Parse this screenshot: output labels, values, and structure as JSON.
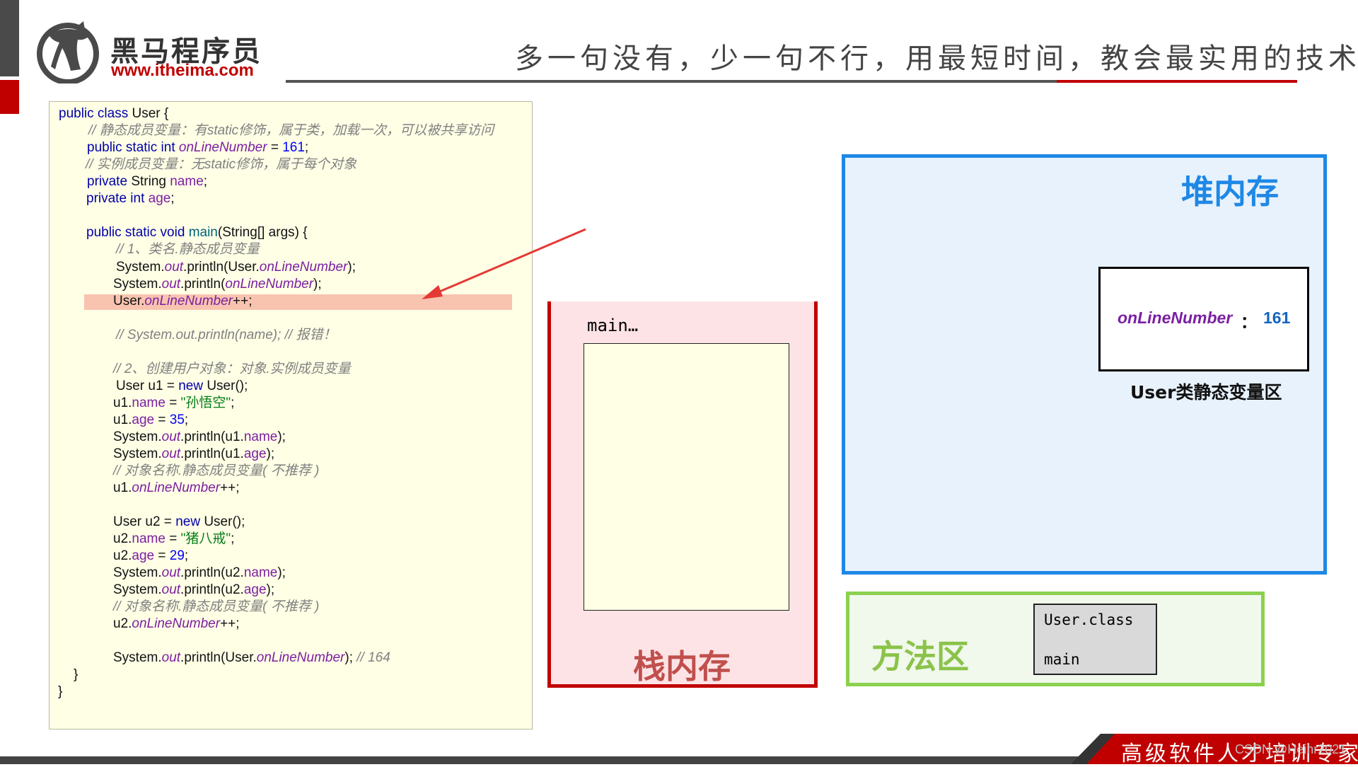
{
  "header": {
    "logo_cn": "黑马程序员",
    "logo_url": "www.itheima.com",
    "slogan": "多一句没有，少一句不行，用最短时间，教会最实用的技术!"
  },
  "code": {
    "l1_a": "public class ",
    "l1_b": "User {",
    "l2": "// 静态成员变量：有static修饰，属于类，加载一次，可以被共享访问",
    "l3_a": "public static int ",
    "l3_b": "onLineNumber",
    "l3_c": " = ",
    "l3_d": "161",
    "l3_e": ";",
    "l4": "// 实例成员变量：无static修饰，属于每个对象",
    "l5_a": "private ",
    "l5_b": "String ",
    "l5_c": "name",
    "l5_d": ";",
    "l6_a": "private int ",
    "l6_b": "age",
    "l6_c": ";",
    "l7_a": "public static void ",
    "l7_b": "main",
    "l7_c": "(String[] args) {",
    "l8": "// 1、类名.静态成员变量",
    "l9_a": "System.",
    "l9_b": "out",
    "l9_c": ".println(User.",
    "l9_d": "onLineNumber",
    "l9_e": ");",
    "l10_a": "System.",
    "l10_b": "out",
    "l10_c": ".println(",
    "l10_d": "onLineNumber",
    "l10_e": ");",
    "l11_a": "User.",
    "l11_b": "onLineNumber",
    "l11_c": "++;",
    "l12": "// System.out.println(name); // 报错！",
    "l13": "// 2、创建用户对象：对象.实例成员变量",
    "l14_a": "User u1 = ",
    "l14_b": "new ",
    "l14_c": "User();",
    "l15_a": "u1.",
    "l15_b": "name",
    "l15_c": " = ",
    "l15_d": "\"孙悟空\"",
    "l15_e": ";",
    "l16_a": "u1.",
    "l16_b": "age",
    "l16_c": " = ",
    "l16_d": "35",
    "l16_e": ";",
    "l17_a": "System.",
    "l17_b": "out",
    "l17_c": ".println(u1.",
    "l17_d": "name",
    "l17_e": ");",
    "l18_a": "System.",
    "l18_b": "out",
    "l18_c": ".println(u1.",
    "l18_d": "age",
    "l18_e": ");",
    "l19": "// 对象名称.静态成员变量( 不推荐 )",
    "l20_a": "u1.",
    "l20_b": "onLineNumber",
    "l20_c": "++;",
    "l21_a": "User u2 = ",
    "l21_b": "new ",
    "l21_c": "User();",
    "l22_a": "u2.",
    "l22_b": "name",
    "l22_c": " = ",
    "l22_d": "\"猪八戒\"",
    "l22_e": ";",
    "l23_a": "u2.",
    "l23_b": "age",
    "l23_c": " = ",
    "l23_d": "29",
    "l23_e": ";",
    "l24_a": "System.",
    "l24_b": "out",
    "l24_c": ".println(u2.",
    "l24_d": "name",
    "l24_e": ");",
    "l25_a": "System.",
    "l25_b": "out",
    "l25_c": ".println(u2.",
    "l25_d": "age",
    "l25_e": ");",
    "l26": "// 对象名称.静态成员变量( 不推荐 )",
    "l27_a": "u2.",
    "l27_b": "onLineNumber",
    "l27_c": "++;",
    "l28_a": "System.",
    "l28_b": "out",
    "l28_c": ".println(User.",
    "l28_d": "onLineNumber",
    "l28_e": "); ",
    "l28_f": "// 164",
    "l29": "}",
    "l30": "}"
  },
  "stack": {
    "frame_label": "main…",
    "title": "栈内存"
  },
  "heap": {
    "title": "堆内存",
    "static_var_name": "onLineNumber",
    "static_colon": "：",
    "static_var_value": "161",
    "static_area_label": "User类静态变量区"
  },
  "method_area": {
    "title": "方法区",
    "class_name": "User.class",
    "method": "main"
  },
  "footer": {
    "tagline": "高级软件人才培训专家",
    "watermark": "CSDN @Heihr2021"
  },
  "colors": {
    "brand_red": "#c00000",
    "heap_blue": "#1e88e5",
    "method_green": "#8bd14f",
    "field_purple": "#7b1fa2"
  }
}
